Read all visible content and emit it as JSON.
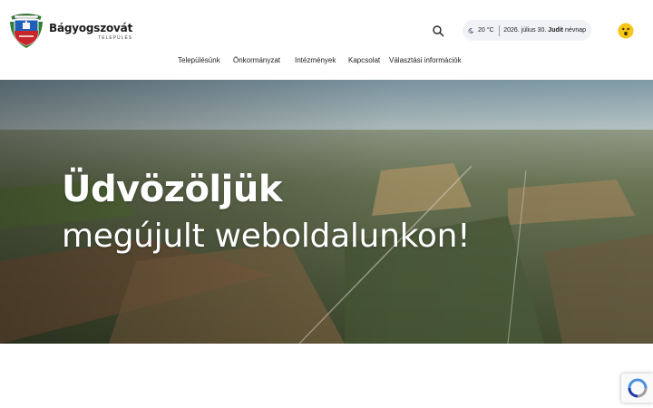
{
  "site": {
    "name": "Bágyogszovát",
    "subtitle": "TELEPÜLÉS"
  },
  "header": {
    "weather": {
      "temperature": "20 °C",
      "icon": "moon-icon"
    },
    "date_prefix": "2026. július 30.",
    "nameday_name": "Judit",
    "nameday_suffix": "névnap",
    "search_icon": "search-icon",
    "accessibility_icon": "emoji-face-icon"
  },
  "nav": {
    "items": [
      {
        "label": "Településünk"
      },
      {
        "label": "Önkormányzat"
      },
      {
        "label": "Intézmények"
      },
      {
        "label": "Kapcsolat"
      },
      {
        "label": "Választási információk"
      }
    ]
  },
  "hero": {
    "title": "Üdvözöljük",
    "subtitle": "megújult weboldalunkon!"
  },
  "colors": {
    "accent_yellow": "#f5c518",
    "pill_bg": "#f1f2f5",
    "crest_blue": "#1f5fb8",
    "crest_red": "#c8262b",
    "crest_green": "#2e7d32"
  }
}
